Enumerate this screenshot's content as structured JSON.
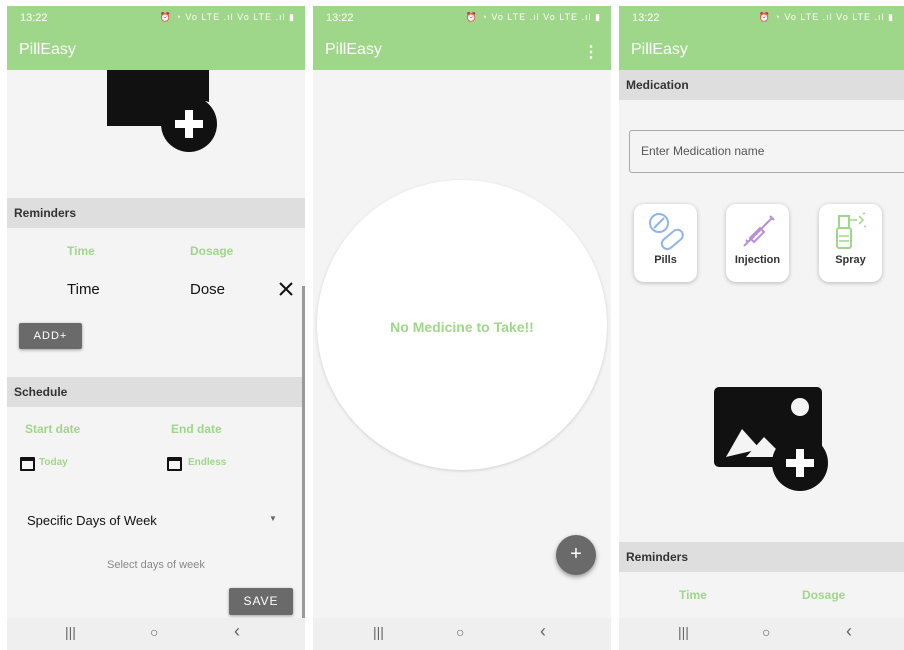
{
  "status_bar": {
    "time": "13:22",
    "icons": "⏰ ◔ Vo LTE .ıl Vo LTE .ıl ▮"
  },
  "app": {
    "title": "PillEasy"
  },
  "screen1": {
    "reminders": {
      "header": "Reminders",
      "time_label": "Time",
      "dosage_label": "Dosage",
      "time_value": "Time",
      "dose_value": "Dose",
      "remove_icon": "close-icon",
      "add_button": "ADD+"
    },
    "schedule": {
      "header": "Schedule",
      "start_label": "Start date",
      "end_label": "End date",
      "start_value": "Today",
      "end_value": "Endless",
      "frequency": "Specific Days of Week",
      "days_hint": "Select days of week",
      "save_button": "SAVE"
    }
  },
  "screen2": {
    "empty_message": "No Medicine to Take!!",
    "fab_label": "+"
  },
  "screen3": {
    "medication_header": "Medication",
    "name_placeholder": "Enter Medication name",
    "types": [
      {
        "label": "Pills",
        "icon": "pills-icon"
      },
      {
        "label": "Injection",
        "icon": "syringe-icon"
      },
      {
        "label": "Spray",
        "icon": "spray-icon"
      }
    ],
    "reminders_header": "Reminders",
    "time_label": "Time",
    "dosage_label": "Dosage"
  },
  "navigation": {
    "recents": "|||",
    "home": "○",
    "back": "‹"
  },
  "colors": {
    "accent": "#9fd78a",
    "button": "#6a6a6a",
    "background": "#f4f4f4",
    "divider": "#dedede"
  }
}
